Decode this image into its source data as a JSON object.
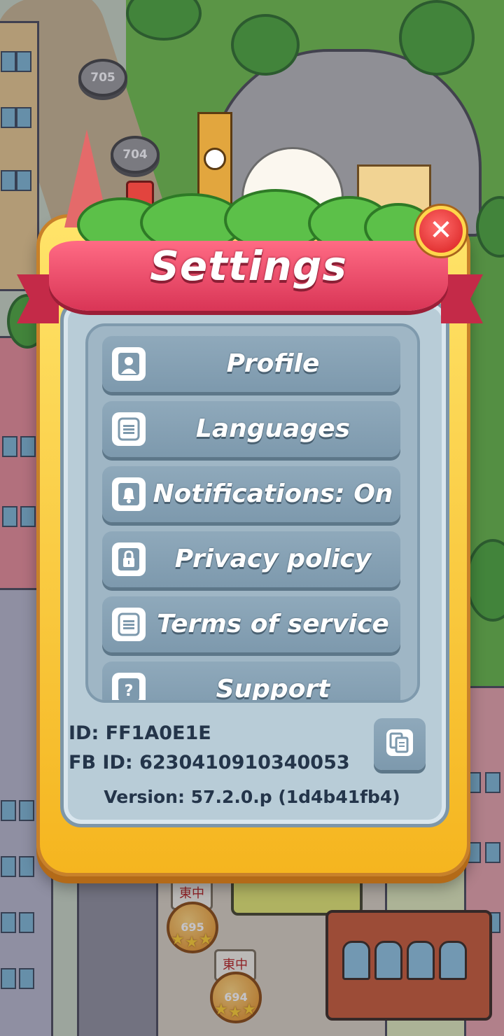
{
  "dialog": {
    "title": "Settings",
    "close_icon": "close-icon"
  },
  "menu": {
    "items": [
      {
        "label": "Profile",
        "icon": "profile-icon"
      },
      {
        "label": "Languages",
        "icon": "list-icon"
      },
      {
        "label": "Notifications: On",
        "icon": "bell-icon"
      },
      {
        "label": "Privacy policy",
        "icon": "lock-icon"
      },
      {
        "label": "Terms of service",
        "icon": "document-icon"
      },
      {
        "label": "Support",
        "icon": "question-icon"
      }
    ]
  },
  "account": {
    "id_line": "ID: FF1A0E1E",
    "fb_id_line": "FB ID: 6230410910340053",
    "version_line": "Version: 57.2.0.p (1d4b41fb4)",
    "copy_icon": "copy-icon"
  },
  "map": {
    "levels": [
      "705",
      "704",
      "695",
      "694"
    ],
    "tile_text": "東中"
  },
  "colors": {
    "ribbon": "#d93556",
    "frame": "#f5b51f",
    "button": "#7d99ad",
    "close": "#d81d1d",
    "text_dark": "#24354a"
  }
}
